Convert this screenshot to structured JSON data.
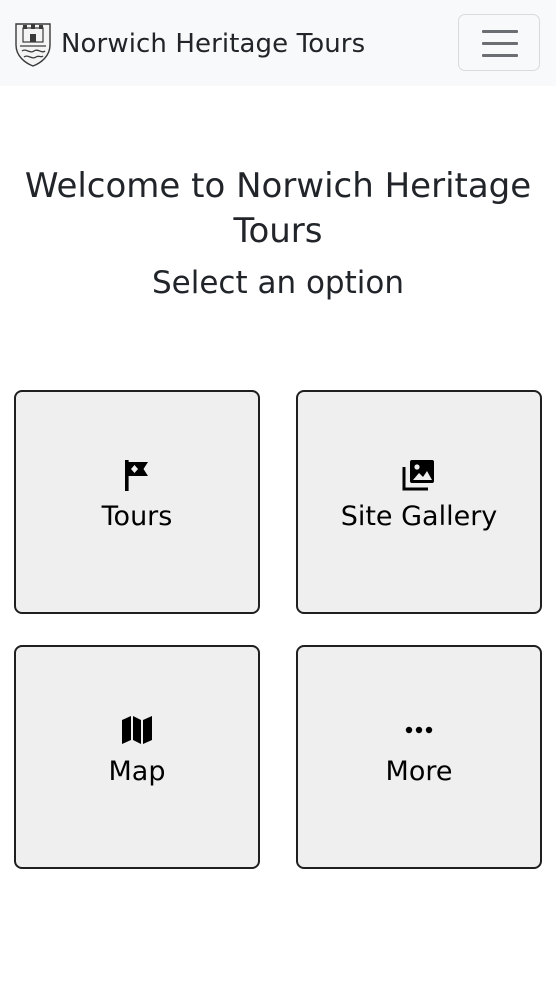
{
  "navbar": {
    "brand": "Norwich Heritage Tours",
    "logo_icon": "coat-of-arms-icon",
    "menu_icon": "hamburger-menu-icon"
  },
  "main": {
    "title": "Welcome to Norwich Heritage Tours",
    "subtitle": "Select an option",
    "options": [
      {
        "label": "Tours",
        "icon": "flag-icon"
      },
      {
        "label": "Site Gallery",
        "icon": "images-icon"
      },
      {
        "label": "Map",
        "icon": "map-icon"
      },
      {
        "label": "More",
        "icon": "more-dots-icon"
      }
    ]
  }
}
